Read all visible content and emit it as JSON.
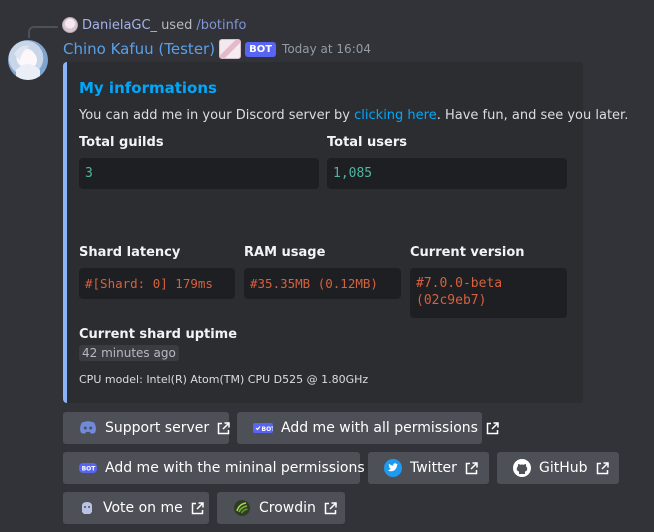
{
  "reply": {
    "username": "DanielaGC_",
    "used": "used",
    "command": "/botinfo"
  },
  "message": {
    "author": "Chino Kafuu (Tester)",
    "bot_tag": "BOT",
    "timestamp": "Today at 16:04"
  },
  "embed": {
    "accent_color": "#8ab4f8",
    "title": "My informations",
    "desc_prefix": "You can add me in your Discord server by ",
    "desc_link": "clicking here",
    "desc_suffix": ". Have fun, and see you later.",
    "fields": {
      "total_guilds": {
        "name": "Total guilds",
        "value": "3"
      },
      "total_users": {
        "name": "Total users",
        "value": "1,085"
      },
      "shard_latency": {
        "name": "Shard latency",
        "value": "#[Shard: 0] 179ms"
      },
      "ram_usage": {
        "name": "RAM usage",
        "value": "#35.35MB (0.12MB)"
      },
      "current_version": {
        "name": "Current version",
        "value_line1": "#7.0.0-beta",
        "value_line2": "(02c9eb7)"
      },
      "uptime": {
        "name": "Current shard uptime",
        "value": "42 minutes ago"
      }
    },
    "footer": "CPU model: Intel(R) Atom(TM) CPU D525   @ 1.80GHz"
  },
  "buttons": {
    "support_server": {
      "label": "Support server",
      "icon": "discord-icon"
    },
    "add_all": {
      "label": "Add me with all permissions",
      "icon": "bot-badge-icon"
    },
    "add_minimal": {
      "label": "Add me with the mininal permissions",
      "icon": "bot-badge-icon"
    },
    "twitter": {
      "label": "Twitter",
      "icon": "twitter-icon"
    },
    "github": {
      "label": "GitHub",
      "icon": "github-icon"
    },
    "vote": {
      "label": "Vote on me",
      "icon": "vote-icon"
    },
    "crowdin": {
      "label": "Crowdin",
      "icon": "crowdin-icon"
    }
  }
}
